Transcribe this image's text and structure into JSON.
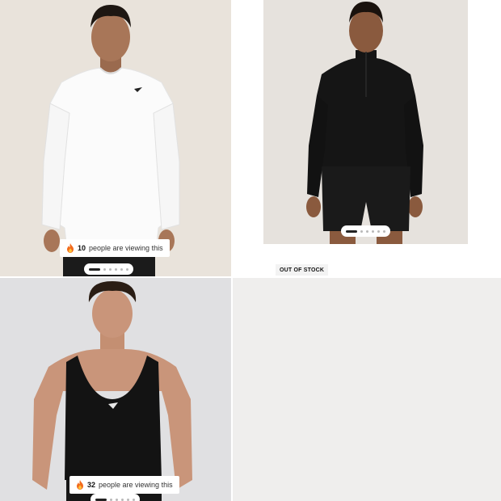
{
  "products": [
    {
      "image_alt": "Man wearing white long sleeve top",
      "viewers": {
        "count": "10",
        "text": "people are viewing this"
      },
      "carousel": {
        "total": 6,
        "active": 0
      }
    },
    {
      "image_alt": "Man wearing black quarter zip base layer and black shorts",
      "stock_label": "OUT OF STOCK",
      "carousel": {
        "total": 6,
        "active": 0
      }
    },
    {
      "image_alt": "Man wearing black stringer tank",
      "viewers": {
        "count": "32",
        "text": "people are viewing this"
      },
      "carousel": {
        "total": 6,
        "active": 0
      }
    },
    {
      "image_alt": "Loading product image"
    }
  ],
  "colors": {
    "card_bg_1": "#e9e3db",
    "card_bg_2": "#e6e2dd",
    "card_bg_3": "#e0e0e2",
    "card_bg_4": "#efeeed",
    "flame": "#f26b1d"
  }
}
